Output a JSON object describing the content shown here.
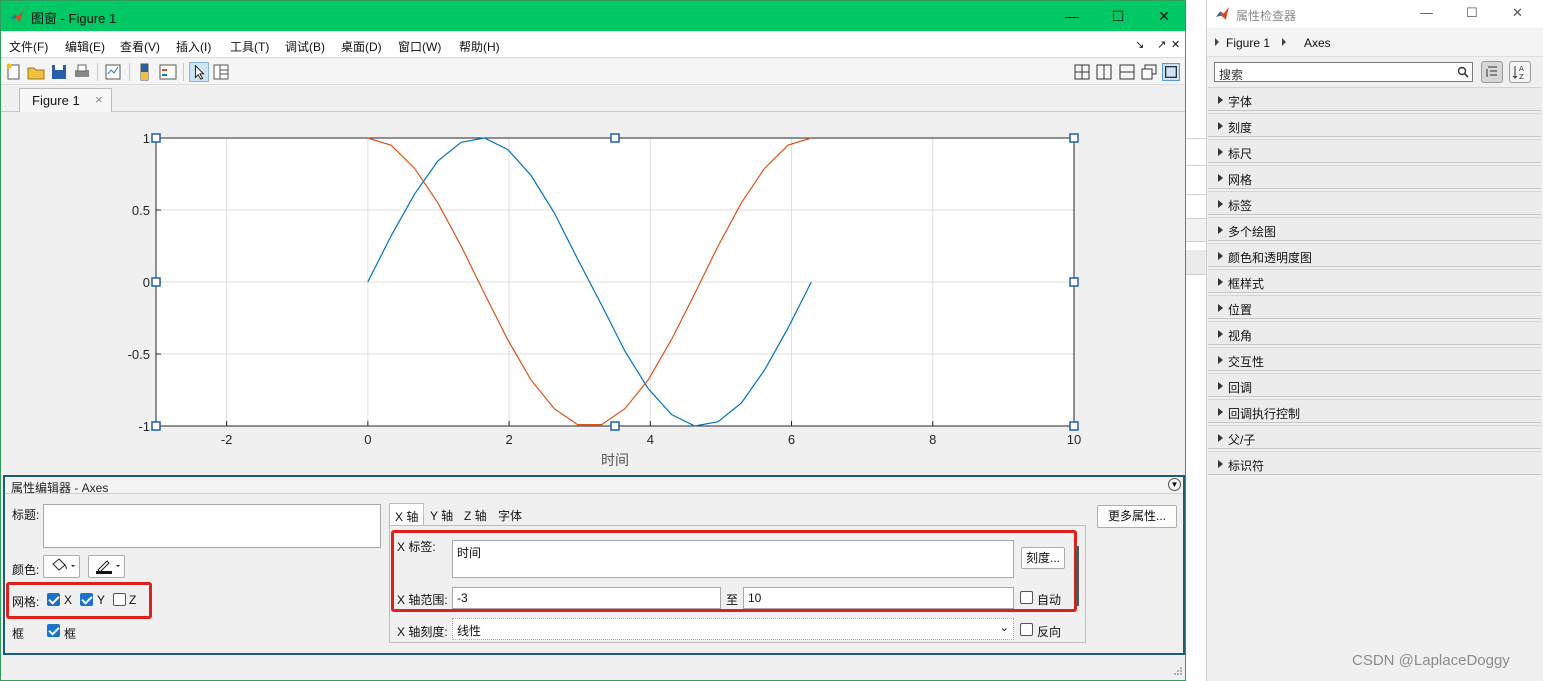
{
  "figure_window": {
    "title": "图窗 - Figure 1",
    "menus": [
      "文件(F)",
      "编辑(E)",
      "查看(V)",
      "插入(I)",
      "工具(T)",
      "调试(B)",
      "桌面(D)",
      "窗口(W)",
      "帮助(H)"
    ],
    "tab_label": "Figure 1",
    "tab_close": "×"
  },
  "chart_data": {
    "type": "line",
    "xlabel": "时间",
    "ylabel": "",
    "xlim": [
      -3,
      10
    ],
    "ylim": [
      -1,
      1
    ],
    "xticks": [
      -2,
      0,
      2,
      4,
      6,
      8,
      10
    ],
    "xtick_labels": [
      "-2",
      "0",
      "2",
      "4",
      "6",
      "8",
      "10"
    ],
    "yticks": [
      -1,
      -0.5,
      0,
      0.5,
      1
    ],
    "ytick_labels": [
      "-1",
      "-0.5",
      "0",
      "0.5",
      "1"
    ],
    "grid": true,
    "series": [
      {
        "color": "#0072bd",
        "x": [
          0,
          0.33,
          0.66,
          0.99,
          1.32,
          1.65,
          1.98,
          2.31,
          2.64,
          2.97,
          3.31,
          3.64,
          3.97,
          4.3,
          4.63,
          4.96,
          5.29,
          5.62,
          5.95,
          6.28
        ],
        "y": [
          0,
          0.32,
          0.61,
          0.84,
          0.97,
          1.0,
          0.92,
          0.74,
          0.48,
          0.16,
          -0.16,
          -0.48,
          -0.74,
          -0.92,
          -1.0,
          -0.97,
          -0.84,
          -0.61,
          -0.32,
          0
        ]
      },
      {
        "color": "#d95319",
        "x": [
          0,
          0.33,
          0.66,
          0.99,
          1.32,
          1.65,
          1.98,
          2.31,
          2.64,
          2.97,
          3.31,
          3.64,
          3.97,
          4.3,
          4.63,
          4.96,
          5.29,
          5.62,
          5.95,
          6.28
        ],
        "y": [
          1.0,
          0.95,
          0.79,
          0.55,
          0.25,
          -0.08,
          -0.4,
          -0.68,
          -0.88,
          -0.99,
          -0.99,
          -0.88,
          -0.68,
          -0.4,
          -0.08,
          0.25,
          0.55,
          0.79,
          0.95,
          1.0
        ]
      }
    ]
  },
  "property_editor": {
    "header": "属性编辑器 - Axes",
    "title_label": "标题:",
    "title_value": "",
    "color_label": "颜色:",
    "grid_label": "网格:",
    "grid_x": {
      "label": "X",
      "checked": true
    },
    "grid_y": {
      "label": "Y",
      "checked": true
    },
    "grid_z": {
      "label": "Z",
      "checked": false
    },
    "box_label": "框",
    "box_check": {
      "label": "框",
      "checked": true
    },
    "tabs": [
      "X 轴",
      "Y 轴",
      "Z 轴",
      "字体"
    ],
    "more_props": "更多属性...",
    "xlabel_label": "X 标签:",
    "xlabel_value": "时间",
    "ticks_button": "刻度...",
    "xrange_label": "X 轴范围:",
    "xrange_min": "-3",
    "to_label": "至",
    "xrange_max": "10",
    "auto": {
      "label": "自动",
      "checked": false
    },
    "xscale_label": "X 轴刻度:",
    "xscale_value": "线性",
    "reverse": {
      "label": "反向",
      "checked": false
    }
  },
  "inspector": {
    "title": "属性检查器",
    "breadcrumb": [
      "Figure 1",
      "Axes"
    ],
    "search_placeholder": "搜索",
    "sections": [
      "字体",
      "刻度",
      "标尺",
      "网格",
      "标签",
      "多个绘图",
      "颜色和透明度图",
      "框样式",
      "位置",
      "视角",
      "交互性",
      "回调",
      "回调执行控制",
      "父/子",
      "标识符"
    ]
  },
  "watermark": "CSDN @LaplaceDoggy",
  "colors": {
    "titlebar": "#00c864",
    "highlight": "#e0201b",
    "series1": "#0072bd",
    "series2": "#d95319"
  }
}
